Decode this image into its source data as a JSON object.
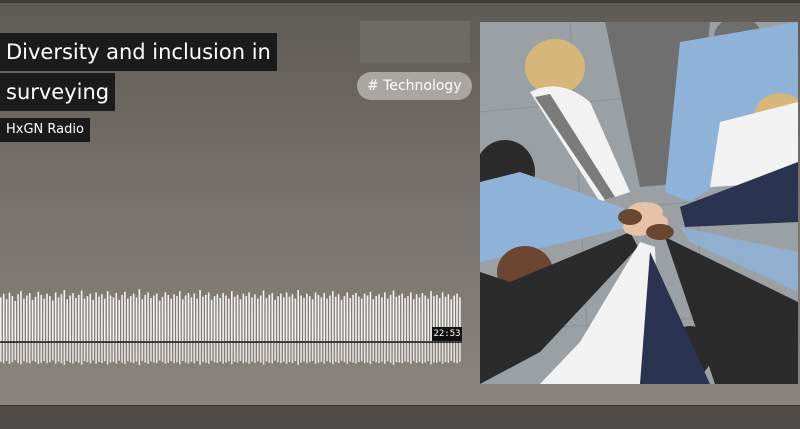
{
  "episode": {
    "title_line_1": "Diversity and inclusion in",
    "title_line_2": "surveying",
    "show_name": "HxGN Radio",
    "tag": "# Technology",
    "duration": "22:53"
  },
  "waveform": {
    "bar_color": "#f2f2f2",
    "baseline_color": "#1a1a1a",
    "levels": [
      0.72,
      0.78,
      0.69,
      0.8,
      0.74,
      0.66,
      0.77,
      0.82,
      0.7,
      0.75,
      0.79,
      0.68,
      0.73,
      0.81,
      0.76,
      0.7,
      0.78,
      0.74,
      0.67,
      0.8,
      0.72,
      0.77,
      0.84,
      0.69,
      0.75,
      0.79,
      0.71,
      0.76,
      0.83,
      0.7,
      0.74,
      0.78,
      0.68,
      0.8,
      0.73,
      0.77,
      0.7,
      0.82,
      0.75,
      0.72,
      0.79,
      0.68,
      0.76,
      0.81,
      0.7,
      0.74,
      0.78,
      0.72,
      0.85,
      0.69,
      0.76,
      0.8,
      0.71,
      0.75,
      0.78,
      0.67,
      0.73,
      0.8,
      0.76,
      0.7,
      0.77,
      0.74,
      0.82,
      0.69,
      0.75,
      0.79,
      0.72,
      0.78,
      0.7,
      0.84,
      0.73,
      0.76,
      0.8,
      0.68,
      0.74,
      0.77,
      0.71,
      0.79,
      0.75,
      0.7,
      0.82,
      0.73,
      0.76,
      0.69,
      0.78,
      0.74,
      0.8,
      0.72,
      0.77,
      0.7,
      0.75,
      0.83,
      0.71,
      0.76,
      0.79,
      0.68,
      0.74,
      0.78,
      0.72,
      0.8,
      0.73,
      0.77,
      0.7,
      0.84,
      0.75,
      0.71,
      0.78,
      0.74,
      0.69,
      0.8,
      0.76,
      0.72,
      0.79,
      0.7,
      0.75,
      0.82,
      0.73,
      0.77,
      0.68,
      0.74,
      0.8,
      0.71,
      0.76,
      0.79,
      0.73,
      0.7,
      0.78,
      0.75,
      0.81,
      0.69,
      0.74,
      0.77,
      0.72,
      0.8,
      0.7,
      0.76,
      0.83,
      0.73,
      0.75,
      0.78,
      0.71,
      0.74,
      0.8,
      0.69,
      0.77,
      0.72,
      0.79,
      0.75,
      0.7,
      0.82,
      0.74,
      0.76,
      0.71,
      0.8,
      0.73,
      0.77,
      0.69,
      0.75,
      0.78,
      0.72
    ]
  },
  "cover_image": {
    "subject": "team-hands-stacked-photo",
    "colors": {
      "floor": "#9aa0a4",
      "skin_light": "#e7c2a6",
      "skin_dark": "#6b4630",
      "shirt_blue": "#8fb3d8",
      "navy": "#2a3450",
      "white": "#f2f2f2",
      "dark": "#2b2b2b",
      "blonde": "#d6b77a",
      "grey": "#6f6f6f"
    }
  }
}
